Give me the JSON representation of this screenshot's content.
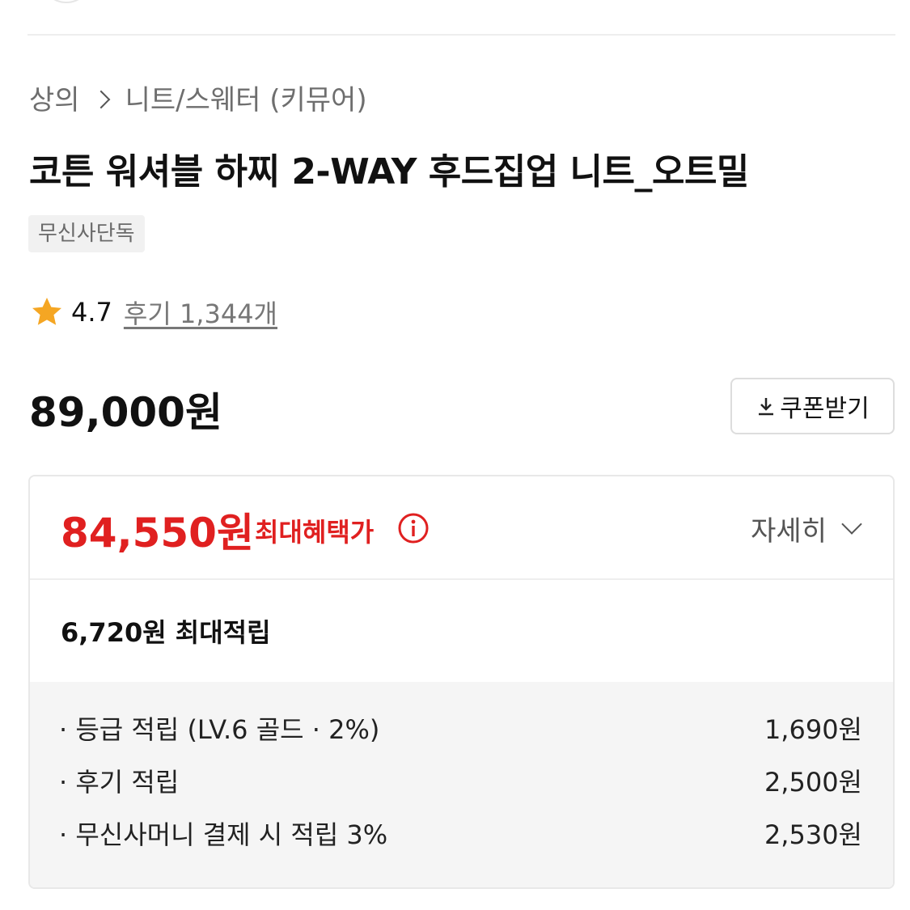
{
  "breadcrumb": {
    "category": "상의",
    "subcategory": "니트/스웨터 (키뮤어)"
  },
  "product": {
    "title": "코튼 워셔블 하찌 2-WAY 후드집업 니트_오트밀",
    "tag": "무신사단독"
  },
  "rating": {
    "icon": "star-icon",
    "star_color": "#f5a623",
    "score": "4.7",
    "reviews": "후기 1,344개"
  },
  "price": {
    "original": "89,000원",
    "coupon_label": "쿠폰받기",
    "coupon_icon": "download-icon"
  },
  "benefit": {
    "max_price": "84,550원",
    "max_label": "최대혜택가",
    "accent_color": "#e02020",
    "info_icon": "info-icon",
    "detail_label": "자세히",
    "detail_icon": "chevron-down-icon",
    "points_total": "6,720원 최대적립",
    "items": [
      {
        "label": "· 등급 적립 (LV.6 골드 · 2%)",
        "value": "1,690원"
      },
      {
        "label": "· 후기 적립",
        "value": "2,500원"
      },
      {
        "label": "· 무신사머니 결제 시 적립 3%",
        "value": "2,530원"
      }
    ]
  }
}
